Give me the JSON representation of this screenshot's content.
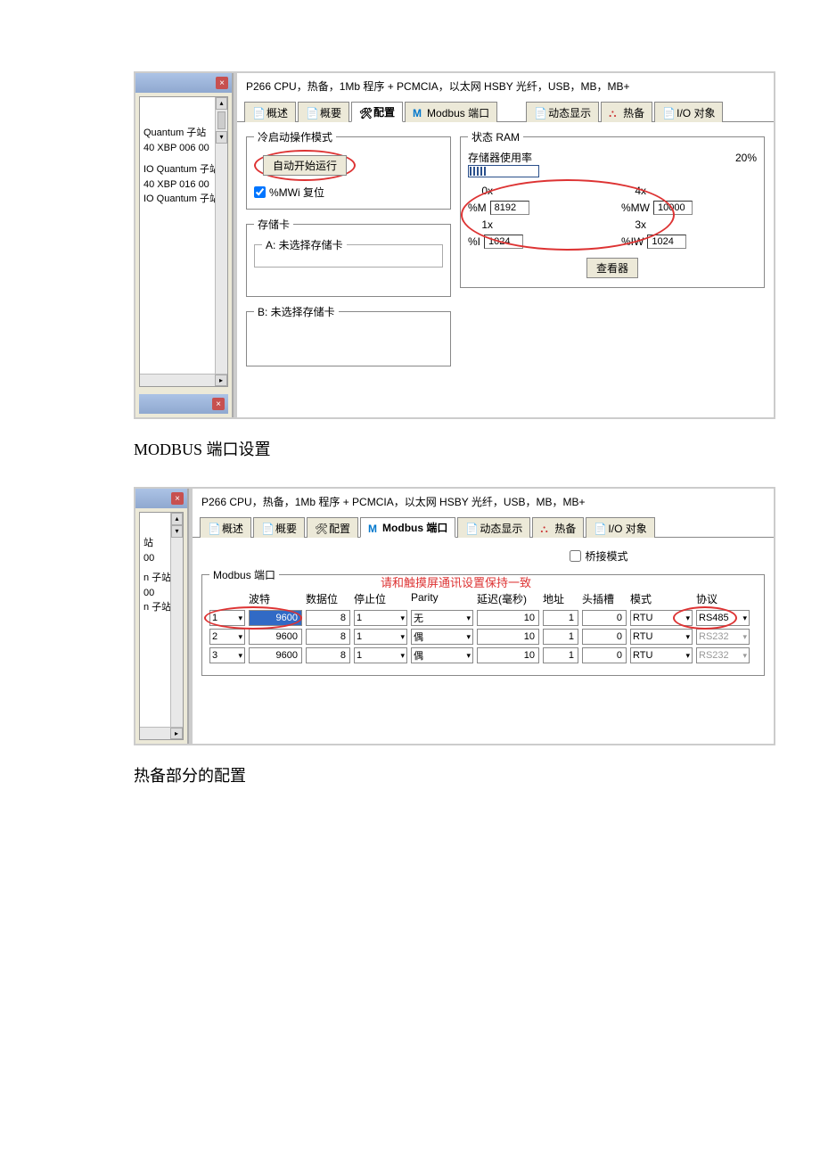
{
  "s1": {
    "titleBar": "P266 CPU，热备，1Mb 程序 + PCMCIA，以太网 HSBY 光纤，USB，MB，MB+",
    "tree": {
      "items": [
        "Quantum 子站",
        "40 XBP 006 00",
        "IO Quantum 子站",
        "40 XBP 016 00",
        "IO Quantum 子站"
      ]
    },
    "tabs": {
      "desc": "概述",
      "summary": "概要",
      "config": "配置",
      "modbus": "Modbus 端口",
      "anim": "动态显示",
      "hotstandby": "热备",
      "io": "I/O 对象"
    },
    "coldStart": {
      "legend": "冷启动操作模式",
      "autoRun": "自动开始运行",
      "resetLabel": "%MWi 复位"
    },
    "cardA": {
      "legend": "存储卡",
      "sub": "A: 未选择存储卡"
    },
    "cardB": {
      "sub": "B: 未选择存储卡"
    },
    "ram": {
      "legend": "状态 RAM",
      "usage": "存储器使用率",
      "pct": "20%",
      "labels": {
        "x0": "0x",
        "x4": "4x",
        "x1": "1x",
        "x3": "3x"
      },
      "prefixes": {
        "m": "%M",
        "mw": "%MW",
        "i": "%I",
        "iw": "%IW"
      },
      "v": {
        "m": "8192",
        "mw": "10000",
        "i": "1024",
        "iw": "1024"
      },
      "viewer": "查看器"
    }
  },
  "caption1": "MODBUS 端口设置",
  "s2": {
    "titleBar": "P266 CPU，热备，1Mb 程序 + PCMCIA，以太网 HSBY 光纤，USB，MB，MB+",
    "tree": {
      "items": [
        "站",
        "00",
        "n 子站",
        "00",
        "n 子站"
      ]
    },
    "tabs": {
      "desc": "概述",
      "summary": "概要",
      "config": "配置",
      "modbus": "Modbus 端口",
      "anim": "动态显示",
      "hotstandby": "热备",
      "io": "I/O 对象"
    },
    "bridge": "桥接模式",
    "portLegend": "Modbus 端口",
    "warn": "请和触摸屏通讯设置保持一致",
    "headers": {
      "port": "",
      "baud": "波特",
      "dbits": "数据位",
      "sbits": "停止位",
      "parity": "Parity",
      "delay": "延迟(毫秒)",
      "addr": "地址",
      "head": "头插槽",
      "mode": "模式",
      "proto": "协议"
    },
    "rows": [
      {
        "port": "1",
        "baud": "9600",
        "dbits": "8",
        "sbits": "1",
        "parity": "无",
        "delay": "10",
        "addr": "1",
        "head": "0",
        "mode": "RTU",
        "proto": "RS485"
      },
      {
        "port": "2",
        "baud": "9600",
        "dbits": "8",
        "sbits": "1",
        "parity": "偶",
        "delay": "10",
        "addr": "1",
        "head": "0",
        "mode": "RTU",
        "proto": "RS232"
      },
      {
        "port": "3",
        "baud": "9600",
        "dbits": "8",
        "sbits": "1",
        "parity": "偶",
        "delay": "10",
        "addr": "1",
        "head": "0",
        "mode": "RTU",
        "proto": "RS232"
      }
    ]
  },
  "caption2": "热备部分的配置"
}
